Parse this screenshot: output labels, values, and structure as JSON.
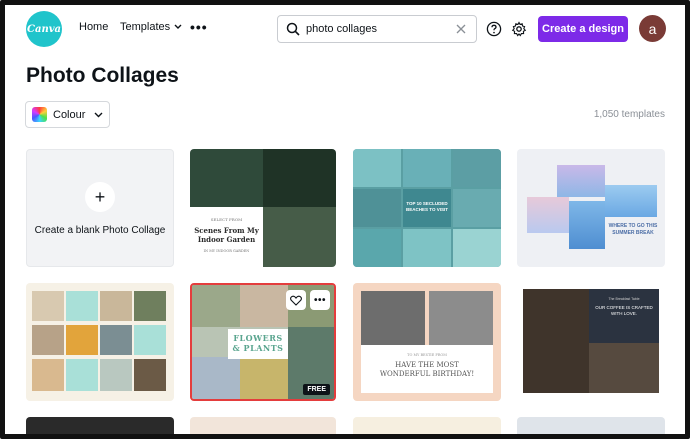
{
  "header": {
    "logo_text": "Canva",
    "nav_home": "Home",
    "nav_templates": "Templates",
    "nav_more": "•••",
    "search_value": "photo collages",
    "create_button": "Create a design",
    "avatar_letter": "a"
  },
  "colors": {
    "brand": "#20c4cb",
    "accent": "#7d2ae8",
    "avatar": "#7a3b36",
    "selection_border": "#e43d3d"
  },
  "page": {
    "title": "Photo Collages",
    "colour_filter_label": "Colour",
    "template_count": "1,050 templates"
  },
  "cards": {
    "blank_label": "Create a blank Photo Collage",
    "indoor_garden": {
      "small": "SELECT FROM",
      "title": "Scenes From My Indoor Garden",
      "footer": "IN MY INDOOR GARDEN"
    },
    "beaches": {
      "title": "TOP 10 SECLUDED BEACHES TO VISIT"
    },
    "summer": {
      "title": "WHERE TO GO THIS SUMMER BREAK"
    },
    "flowers": {
      "title": "FLOWERS & PLANTS",
      "badge": "FREE"
    },
    "birthday": {
      "small": "TO MY BESTIE FROM",
      "title": "HAVE THE MOST WONDERFUL BIRTHDAY!"
    },
    "coffee": {
      "small": "The Breakfast Table",
      "title": "OUR COFFEE IS CRAFTED WITH LOVE."
    }
  },
  "icons": [
    "search-icon",
    "clear-icon",
    "help-icon",
    "gear-icon",
    "chevron-down-icon",
    "plus-icon",
    "heart-icon",
    "more-icon"
  ]
}
